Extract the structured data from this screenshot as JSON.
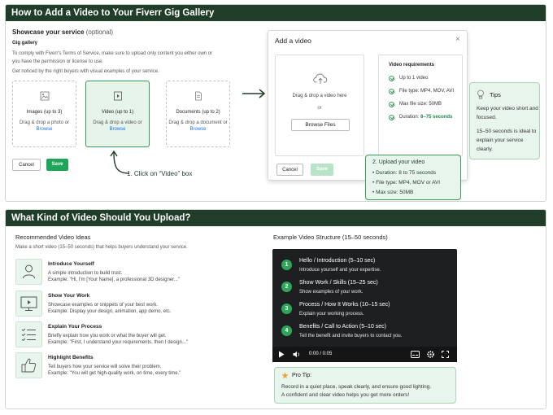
{
  "section1": {
    "header": "How to Add a Video to Your Fiverr Gig Gallery",
    "showcase_title": "Showcase your service",
    "showcase_optional": "(optional)",
    "gallery_label": "Gig gallery",
    "gallery_text1": "To comply with Fiverr's Terms of Service, make sure to upload only content you either own or",
    "gallery_text2": "you have the permission or license to use.",
    "gallery_text3": "Get noticed by the right buyers with visual examples of your service.",
    "boxes": [
      {
        "title": "Images (up to 3)",
        "text": "Drag & drop a photo or",
        "link": "Browse"
      },
      {
        "title": "Video (up to 1)",
        "text": "Drag & drop a video or",
        "link": "Browse"
      },
      {
        "title": "Documents (up to 2)",
        "text": "Drag & drop a document or",
        "link": "Browse"
      }
    ],
    "cancel": "Cancel",
    "save": "Save",
    "click_hint": "1. Click on “Video” box",
    "modal": {
      "title": "Add a video",
      "drop_text": "Drag & drop a video here",
      "or": "or",
      "browse": "Browse Files",
      "req_title": "Video requirements",
      "requirements": [
        "Up to 1 video",
        "File type: MP4, MOV, AVI",
        "Max file size: 50MB"
      ],
      "duration_label": "Duration:",
      "duration_value": "8–75 seconds",
      "cancel": "Cancel",
      "save": "Save"
    },
    "upload_step": {
      "title": "2. Upload your video",
      "items": [
        "Duration: 8 to 75 seconds",
        "File type: MP4, MOV or AVI",
        "Max size: 50MB"
      ]
    },
    "tips": {
      "title": "Tips",
      "text1": "Keep your video short and focused.",
      "text2": "15–50 seconds is ideal to explain your service clearly."
    }
  },
  "section2": {
    "header": "What Kind of Video Should You Upload?",
    "rec_title": "Recommended Video Ideas",
    "rec_sub": "Make a short video (15–50 seconds) that helps buyers understand your service.",
    "ideas": [
      {
        "icon": "user-icon",
        "title": "Introduce Yourself",
        "desc1": "A simple introduction to build trust.",
        "desc2": "Example: \"Hi, I'm [Your Name], a professional 3D designer...\""
      },
      {
        "icon": "monitor-icon",
        "title": "Show Your Work",
        "desc1": "Showcase examples or snippets of your best work.",
        "desc2": "Example: Display your design, animation, app demo, etc."
      },
      {
        "icon": "checklist-icon",
        "title": "Explain Your Process",
        "desc1": "Briefly explain how you work or what the buyer will get.",
        "desc2": "Example: \"First, I understand your requirements, then I design...\""
      },
      {
        "icon": "thumbs-up-icon",
        "title": "Highlight Benefits",
        "desc1": "Tell buyers how your service will solve their problem.",
        "desc2": "Example: \"You will get high-quality work, on time, every time.\""
      }
    ],
    "structure_title": "Example Video Structure (15–50 seconds)",
    "steps": [
      {
        "num": "1",
        "title": "Hello / Introduction (5–10 sec)",
        "desc": "Introduce yourself and your expertise."
      },
      {
        "num": "2",
        "title": "Show Work / Skills (15–25 sec)",
        "desc": "Show examples of your work."
      },
      {
        "num": "3",
        "title": "Process / How It Works (10–15 sec)",
        "desc": "Explain your working process."
      },
      {
        "num": "4",
        "title": "Benefits / Call to Action (5–10 sec)",
        "desc": "Tell the benefit and invite buyers to contact you."
      }
    ],
    "player_time": "0:00 / 0:05",
    "pro_tip": {
      "title": "Pro Tip:",
      "text1": "Record in a quiet place, speak clearly, and ensure good lighting.",
      "text2": "A confident and clear video helps you get more orders!"
    }
  },
  "colors": {
    "header_bg": "#1f3d28",
    "accent_green": "#1da55a",
    "link_blue": "#1e6fd9",
    "light_green_bg": "#e8f5ec"
  }
}
